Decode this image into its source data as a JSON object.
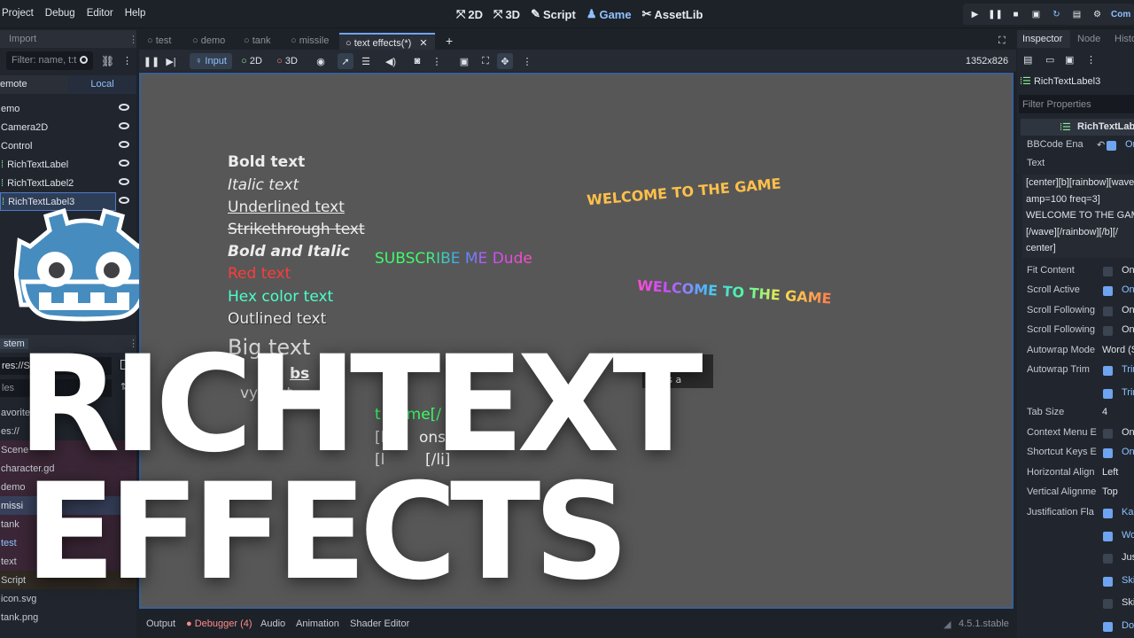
{
  "menu": [
    "Project",
    "Debug",
    "Editor",
    "Help"
  ],
  "modes": [
    {
      "icon": "2d-icon",
      "glyph": "⤧",
      "label": "2D"
    },
    {
      "icon": "3d-icon",
      "glyph": "⤧",
      "label": "3D"
    },
    {
      "icon": "script-icon",
      "glyph": "✎",
      "label": "Script"
    },
    {
      "icon": "game-icon",
      "glyph": "♟",
      "label": "Game"
    },
    {
      "icon": "assetlib-icon",
      "glyph": "✂",
      "label": "AssetLib"
    }
  ],
  "playbar": {
    "label": "Com"
  },
  "left": {
    "import_tab": "Import",
    "filter_placeholder": "Filter: name, t:t",
    "remote_tab": "emote",
    "local_tab": "Local",
    "tree": [
      {
        "label": "emo",
        "selected": false
      },
      {
        "label": "Camera2D",
        "selected": false
      },
      {
        "label": "Control",
        "selected": false
      },
      {
        "label": "RichTextLabel",
        "selected": false
      },
      {
        "label": "RichTextLabel2",
        "selected": false
      },
      {
        "label": "RichTextLabel3",
        "selected": true
      }
    ],
    "fs_title": "stem",
    "fs_path": "res://S",
    "fs_files": "les",
    "files": [
      "avorite",
      "es://",
      "Scene",
      "character.gd",
      "demo",
      "missi",
      "tank",
      "test",
      "text",
      "Script",
      "icon.svg",
      "tank.png"
    ]
  },
  "tabs": [
    {
      "label": "test"
    },
    {
      "label": "demo"
    },
    {
      "label": "tank"
    },
    {
      "label": "missile"
    },
    {
      "label": "text effects(*)"
    }
  ],
  "toolbar": {
    "input": "Input",
    "mode2d": "2D",
    "mode3d": "3D",
    "resolution": "1352x826"
  },
  "viewport": {
    "bold": "Bold text",
    "italic": "Italic text",
    "underlined": "Underlined text",
    "strike": "Strikethrough text",
    "bolditalic": "Bold and Italic",
    "red": "Red text",
    "hex": "Hex color text",
    "outlined": "Outlined text",
    "big": "Big text",
    "subscribe": "SUBSCRIBE ME Dude",
    "welcome1": "WELCOME TO THE GAME",
    "welcome2": "WELCOME TO THE GAME",
    "partial_bs": "bs",
    "partial_vy": "vy text",
    "list1_a": "t Game[/",
    "list2_a": "[l",
    "list2_b": "ons[/li]",
    "list3_a": "[l",
    "list3_b": "[/li]",
    "tooltip_title": "er",
    "tooltip_text": "his is a"
  },
  "overlay": {
    "line1": "RICHTEXT",
    "line2": "EFFECTS"
  },
  "bottom": {
    "output": "Output",
    "debugger": "Debugger (4)",
    "audio": "Audio",
    "animation": "Animation",
    "shader": "Shader Editor",
    "version": "4.5.1.stable"
  },
  "inspector": {
    "tab_inspector": "Inspector",
    "tab_node": "Node",
    "tab_history": "Histo",
    "node_name": "RichTextLabel3",
    "filter_placeholder": "Filter Properties",
    "class_name": "RichTextLabe",
    "bbcode_label": "BBCode Ena",
    "on": "On",
    "text_label": "Text",
    "text_lines": [
      "[center][b][rainbow][wave",
      "amp=100 freq=3]",
      "WELCOME TO THE GAME",
      "[/wave][/rainbow][/b][/",
      "center]"
    ],
    "props": [
      {
        "label": "Fit Content",
        "value": "On",
        "checked": false
      },
      {
        "label": "Scroll Active",
        "value": "On",
        "checked": true
      },
      {
        "label": "Scroll Following",
        "value": "On",
        "checked": false
      },
      {
        "label": "Scroll Following",
        "value": "On",
        "checked": false
      },
      {
        "label": "Autowrap Mode",
        "value": "Word (S",
        "checked": null
      },
      {
        "label": "Autowrap Trim",
        "value": "Trim",
        "checked": true
      },
      {
        "label": "",
        "value": "Trim",
        "checked": true
      },
      {
        "label": "Tab Size",
        "value": "4",
        "checked": null
      },
      {
        "label": "Context Menu E",
        "value": "On",
        "checked": false
      },
      {
        "label": "Shortcut Keys E",
        "value": "On",
        "checked": true
      },
      {
        "label": "Horizontal Align",
        "value": "Left",
        "checked": null
      },
      {
        "label": "Vertical Alignme",
        "value": "Top",
        "checked": null
      },
      {
        "label": "Justification Fla",
        "value": "Kas",
        "checked": true
      },
      {
        "label": "",
        "value": "Wor",
        "checked": true
      },
      {
        "label": "",
        "value": "Just",
        "checked": false
      },
      {
        "label": "",
        "value": "Skip",
        "checked": true
      },
      {
        "label": "",
        "value": "Skip",
        "checked": false
      },
      {
        "label": "",
        "value": "Do",
        "checked": true
      }
    ]
  },
  "colors": {
    "accent": "#6fa4f0",
    "godot_blue": "#478cbf",
    "viewport_bg": "#575757",
    "red_text": "#ff3b3b",
    "hex_text": "#4affc8",
    "gold": "#ffc04a",
    "debugger": "#ff8b8b"
  }
}
